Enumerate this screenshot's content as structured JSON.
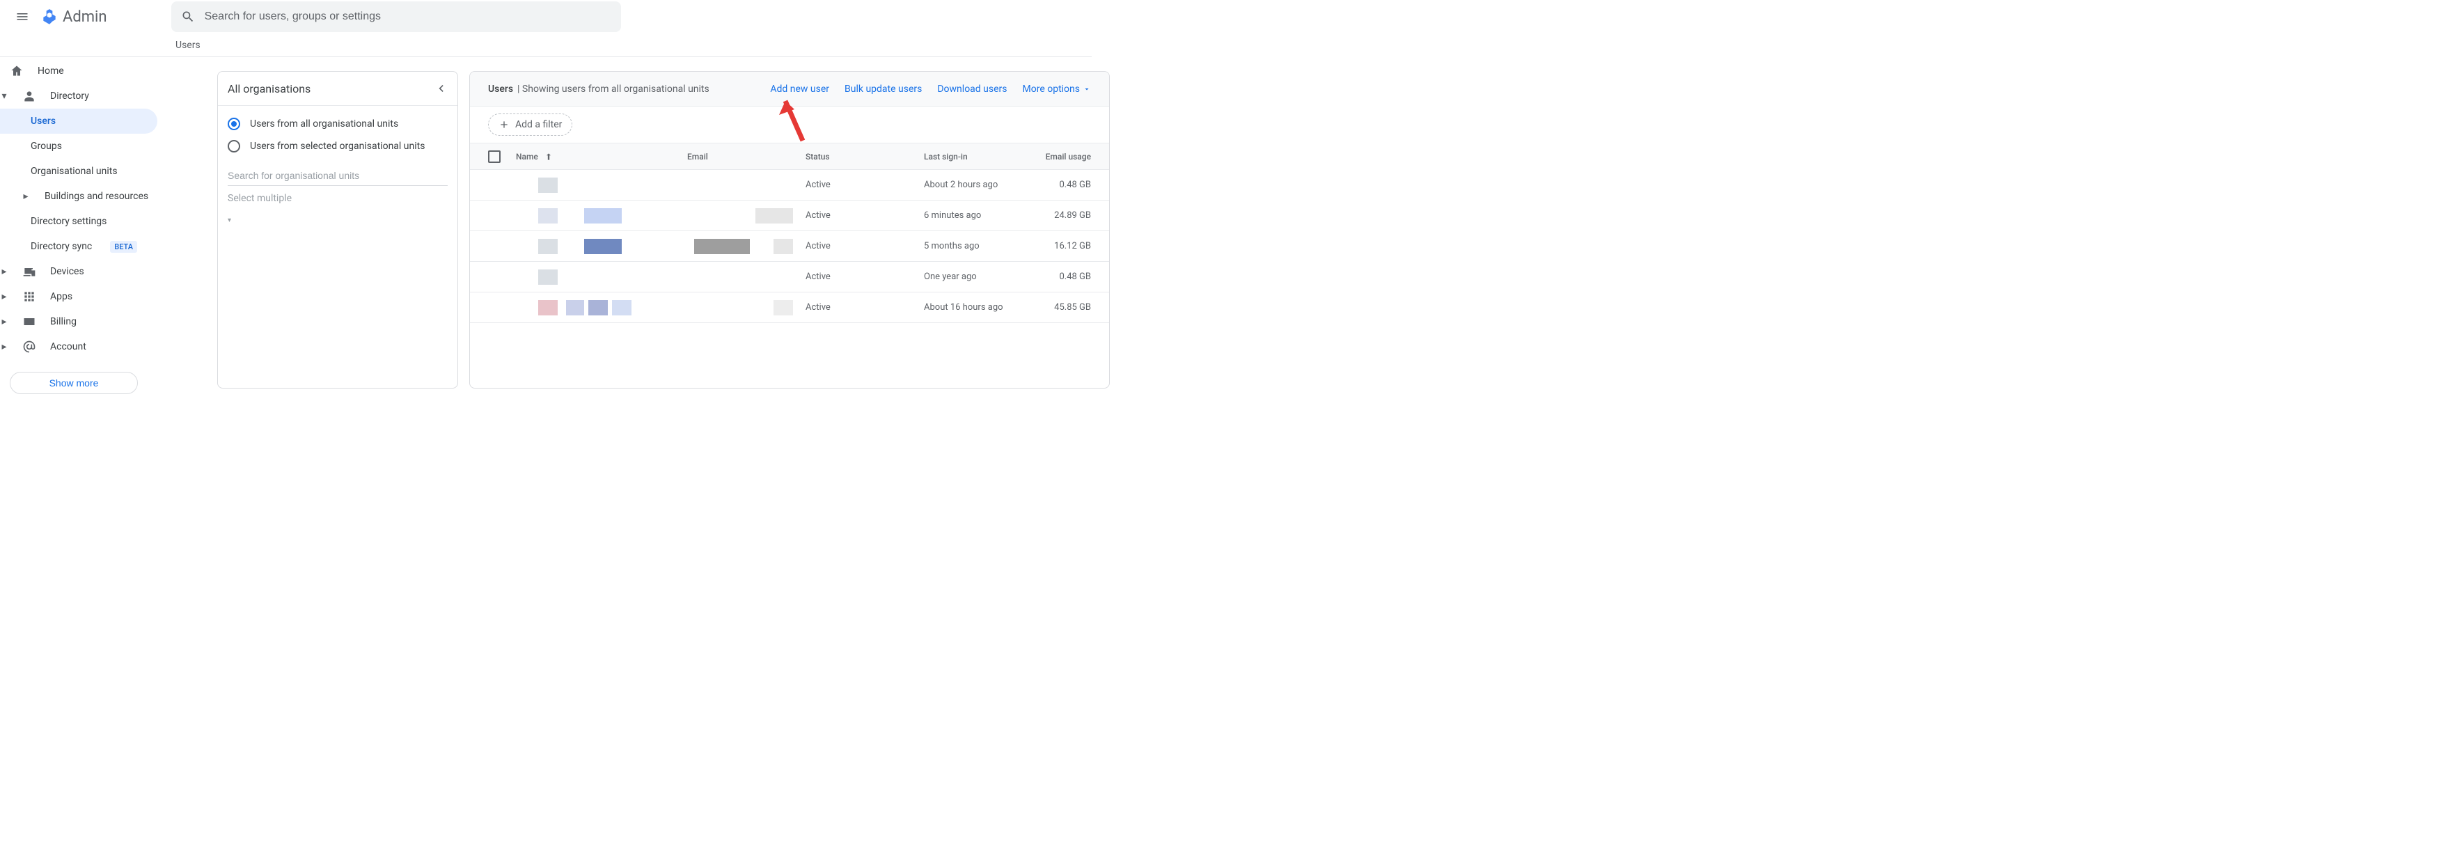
{
  "header": {
    "app_name": "Admin",
    "search_placeholder": "Search for users, groups or settings"
  },
  "breadcrumb": "Users",
  "sidebar": {
    "home": "Home",
    "directory": "Directory",
    "users": "Users",
    "groups": "Groups",
    "org_units": "Organisational units",
    "buildings": "Buildings and resources",
    "dir_settings": "Directory settings",
    "dir_sync": "Directory sync",
    "dir_sync_badge": "BETA",
    "devices": "Devices",
    "apps": "Apps",
    "billing": "Billing",
    "account": "Account",
    "show_more": "Show more"
  },
  "org_panel": {
    "title": "All organisations",
    "opt_all": "Users from all organisational units",
    "opt_sel": "Users from selected organisational units",
    "search_placeholder": "Search for organisational units",
    "select_multiple": "Select multiple"
  },
  "users_panel": {
    "title_bold": "Users",
    "title_rest": " | Showing users from all organisational units",
    "actions": {
      "add": "Add new user",
      "bulk": "Bulk update users",
      "download": "Download users",
      "more": "More options"
    },
    "add_filter": "Add a filter",
    "cols": {
      "name": "Name",
      "email": "Email",
      "status": "Status",
      "signin": "Last sign-in",
      "usage": "Email usage"
    },
    "rows": [
      {
        "status": "Active",
        "signin": "About 2 hours ago",
        "usage": "0.48 GB",
        "name_bars": [
          [
            "#dadfe4",
            28
          ]
        ],
        "email_bars": []
      },
      {
        "status": "Active",
        "signin": "6 minutes ago",
        "usage": "24.89 GB",
        "name_bars": [
          [
            "#dde2ee",
            28
          ],
          [
            "#ffffff",
            26
          ],
          [
            "#c5d3f3",
            54
          ]
        ],
        "email_bars": [
          [
            "#e6e6e6",
            54
          ]
        ]
      },
      {
        "status": "Active",
        "signin": "5 months ago",
        "usage": "16.12 GB",
        "name_bars": [
          [
            "#dadfe4",
            28
          ],
          [
            "#ffffff",
            26
          ],
          [
            "#7089c0",
            54
          ]
        ],
        "email_bars": [
          [
            "#9e9e9e",
            80
          ],
          [
            "#ffffff",
            26
          ],
          [
            "#e6e6e6",
            28
          ]
        ]
      },
      {
        "status": "Active",
        "signin": "One year ago",
        "usage": "0.48 GB",
        "name_bars": [
          [
            "#dadfe4",
            28
          ]
        ],
        "email_bars": []
      },
      {
        "status": "Active",
        "signin": "About 16 hours ago",
        "usage": "45.85 GB",
        "name_bars": [
          [
            "#e9c3c9",
            28
          ],
          [
            "#ffffff",
            0
          ],
          [
            "#c9d0ea",
            26
          ],
          [
            "#a9b3d8",
            28
          ],
          [
            "#d3ddf3",
            28
          ]
        ],
        "email_bars": [
          [
            "#ededed",
            28
          ]
        ]
      }
    ]
  }
}
